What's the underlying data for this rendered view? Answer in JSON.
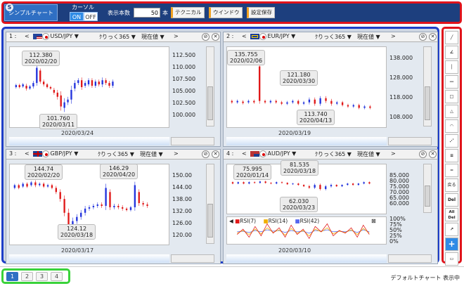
{
  "toolbar": {
    "logo": "S",
    "title": "シンプルチャート",
    "cursor_label": "カーソル",
    "cursor_on": "ON",
    "cursor_off": "OFF",
    "display_count_label": "表示本数",
    "display_count_value": "50",
    "display_count_unit": "本",
    "technical_label": "テクニカル",
    "window_label": "ウインドウ",
    "save_settings_label": "設定保存"
  },
  "charts": [
    {
      "num": "1 :",
      "symbol": "USD/JPY ▼",
      "period": "ｸりっく365 ▼",
      "price_type": "現在値 ▼",
      "axis": [
        "112.500",
        "110.000",
        "107.500",
        "105.000",
        "102.500",
        "100.000"
      ],
      "high": {
        "value": "112.380",
        "date": "2020/02/20"
      },
      "low": {
        "value": "101.760",
        "date": "2020/03/11"
      },
      "cursor_date": "2020/03/24",
      "colors": {
        "up": "#2233dd",
        "down": "#e01818"
      }
    },
    {
      "num": "2 :",
      "symbol": "EUR/JPY ▼",
      "period": "ｸりっく365 ▼",
      "price_type": "現在値 ▼",
      "axis": [
        "138.000",
        "128.000",
        "118.000",
        "108.000"
      ],
      "high": {
        "value": "135.755",
        "date": "2020/02/06"
      },
      "mid": {
        "value": "121.180",
        "date": "2020/03/30"
      },
      "low": {
        "value": "113.740",
        "date": "2020/04/13"
      },
      "cursor_date": "2020/03/19",
      "colors": {
        "up": "#2233dd",
        "down": "#e01818"
      }
    },
    {
      "num": "3 :",
      "symbol": "GBP/JPY ▼",
      "period": "ｸりっく365 ▼",
      "price_type": "現在値 ▼",
      "axis": [
        "150.00",
        "144.00",
        "138.00",
        "132.00",
        "126.00",
        "120.00"
      ],
      "high": {
        "value": "144.74",
        "date": "2020/02/20"
      },
      "high2": {
        "value": "146.29",
        "date": "2020/04/20"
      },
      "low": {
        "value": "124.12",
        "date": "2020/03/18"
      },
      "cursor_date": "2020/03/17",
      "colors": {
        "up": "#2233dd",
        "down": "#e01818"
      }
    },
    {
      "num": "4 :",
      "symbol": "AUD/JPY ▼",
      "period": "ｸりっく365 ▼",
      "price_type": "現在値 ▼",
      "axis": [
        "85.000",
        "80.000",
        "75.000",
        "70.000",
        "65.000",
        "60.000"
      ],
      "high": {
        "value": "75.995",
        "date": "2020/01/14"
      },
      "high2": {
        "value": "81.535",
        "date": "2020/03/18"
      },
      "low": {
        "value": "62.030",
        "date": "2020/03/23"
      },
      "rsi_labels": [
        "RSI(7)",
        "RSI(14)",
        "RSI(42)"
      ],
      "rsi_axis": [
        "100%",
        "75%",
        "50%",
        "25%",
        "0%"
      ],
      "cursor_date": "2020/03/10",
      "colors": {
        "up": "#2233dd",
        "down": "#e01818",
        "rsi7": "#e01818",
        "rsi14": "#f0b000",
        "rsi42": "#5566ee"
      }
    }
  ],
  "drawing_tools": {
    "back_label": "戻る",
    "del_label": "Del",
    "all_del_label": "All Del"
  },
  "pages": [
    "1",
    "2",
    "3",
    "4"
  ],
  "status": "デフォルトチャート 表示中"
}
